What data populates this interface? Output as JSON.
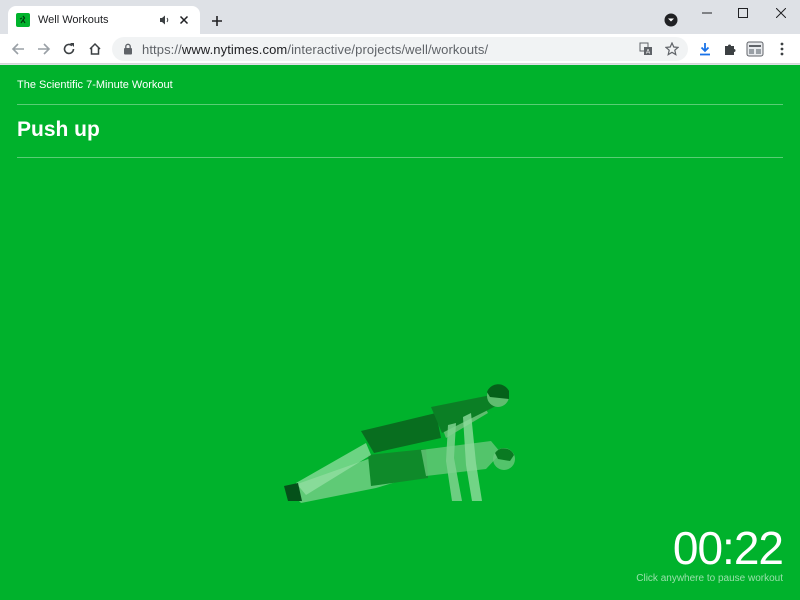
{
  "browser": {
    "tab": {
      "title": "Well Workouts",
      "favicon": "runner-favicon",
      "audio_icon": "speaker-icon",
      "close_icon": "close-icon"
    },
    "new_tab_icon": "plus-icon",
    "profile_icon": "profile-dropdown-icon",
    "window_controls": [
      "minimize-icon",
      "maximize-icon",
      "close-icon"
    ],
    "toolbar": {
      "back_icon": "back-arrow-icon",
      "forward_icon": "forward-arrow-icon",
      "reload_icon": "reload-icon",
      "home_icon": "home-icon",
      "lock_icon": "lock-icon",
      "url_scheme": "https://",
      "url_host": "www.nytimes.com",
      "url_path": "/interactive/projects/well/workouts/",
      "translate_icon": "translate-icon",
      "bookmark_icon": "star-icon",
      "download_icon": "download-icon",
      "extensions_icon": "puzzle-icon",
      "profile_icon": "avatar-icon",
      "menu_icon": "kebab-menu-icon"
    }
  },
  "page": {
    "background": "#00b22c",
    "kicker": "The Scientific 7-Minute Workout",
    "exercise_title": "Push up",
    "timer": "00:22",
    "hint": "Click anywhere to pause workout",
    "illustration": "push-up-figure"
  }
}
